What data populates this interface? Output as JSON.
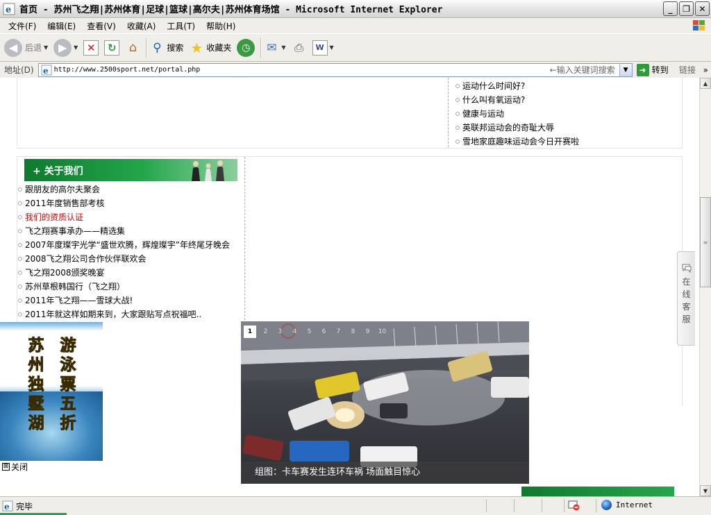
{
  "window": {
    "title": "首页 - 苏州飞之翔|苏州体育|足球|篮球|高尔夫|苏州体育场馆 - Microsoft Internet Explorer",
    "buttons": {
      "minimize": "_",
      "restore": "❐",
      "close": "✕"
    }
  },
  "menubar": {
    "items": [
      "文件(F)",
      "编辑(E)",
      "查看(V)",
      "收藏(A)",
      "工具(T)",
      "帮助(H)"
    ]
  },
  "toolbar": {
    "back_label": "后退",
    "search_label": "搜索",
    "favorites_label": "收藏夹"
  },
  "addressbar": {
    "label": "地址(D)",
    "url": "http://www.2500sport.net/portal.php",
    "keyword_hint": "←输入关键词搜索",
    "go_label": "转到",
    "links_label": "链接",
    "chevron": "»"
  },
  "top_list": {
    "items": [
      "运动什么时间好?",
      "什么叫有氧运动?",
      "健康与运动",
      "英联邦运动会的奇耻大辱",
      "雪地家庭趣味运动会今日开赛啦"
    ]
  },
  "about": {
    "title": "+ 关于我们",
    "items": [
      "跟朋友的高尔夫聚会",
      "2011年度销售部考核",
      "我们的资质认证",
      "飞之翔赛事承办——精选集",
      "2007年度璨宇光学“盛世欢腾，辉煌璨宇”年终尾牙晚会",
      "2008飞之翔公司合作伙伴联欢会",
      "飞之翔2008颁奖晚宴",
      "苏州草根韩国行（飞之翔）",
      "2011年飞之翔——雪球大战!",
      "2011年就这样如期来到，大家跟贴写点祝福吧.."
    ],
    "highlight_index": 2,
    "highlight_color": "#cc0000"
  },
  "ad": {
    "col1": [
      "苏",
      "州",
      "独",
      "墅",
      "湖"
    ],
    "col2": [
      "游",
      "泳",
      "票",
      "五",
      "折"
    ],
    "close_icon": "⊠",
    "close_label": "关闭"
  },
  "slideshow": {
    "pages": [
      "1",
      "2",
      "3",
      "4",
      "5",
      "6",
      "7",
      "8",
      "9",
      "10"
    ],
    "active_page": "1",
    "caption": "组图：卡车赛发生连环车祸 场面触目惊心"
  },
  "service": {
    "chars": [
      "在",
      "线",
      "客",
      "服"
    ]
  },
  "status": {
    "text": "完毕",
    "zone": "Internet"
  },
  "colors": {
    "accent_green": "#1a9a3f",
    "link_red": "#cc0000"
  }
}
